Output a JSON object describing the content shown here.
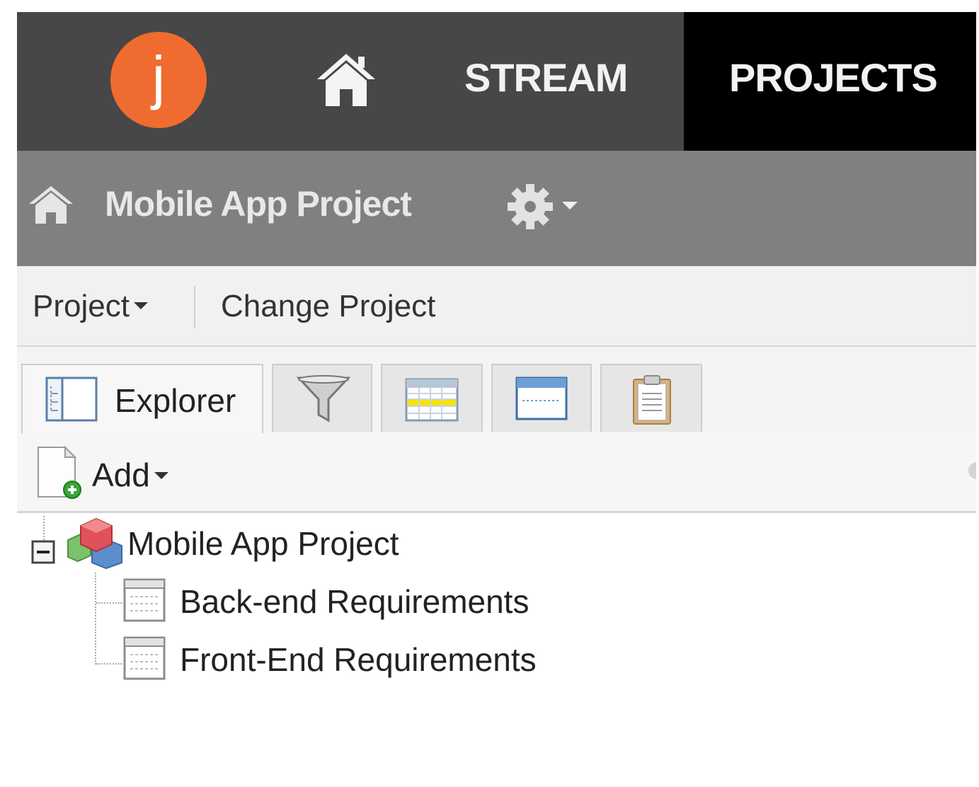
{
  "topnav": {
    "logo_letter": "j",
    "stream_label": "STREAM",
    "projects_label": "PROJECTS",
    "home_icon": "home-icon",
    "colors": {
      "bar": "#474747",
      "active": "#000000",
      "logo": "#f06b2f"
    }
  },
  "project_header": {
    "title": "Mobile App Project",
    "home_icon": "home-icon",
    "settings_icon": "gear-icon",
    "bar_color": "#808080"
  },
  "menubar": {
    "project_menu": "Project",
    "change_project": "Change Project"
  },
  "tabs": [
    {
      "label": "Explorer",
      "icon": "explorer-icon",
      "active": true
    },
    {
      "label": "",
      "icon": "filter-icon",
      "active": false
    },
    {
      "label": "",
      "icon": "grid-icon",
      "active": false
    },
    {
      "label": "",
      "icon": "form-icon",
      "active": false
    },
    {
      "label": "",
      "icon": "clipboard-icon",
      "active": false
    }
  ],
  "toolbar": {
    "add_label": "Add"
  },
  "tree": {
    "root": {
      "label": "Mobile App Project",
      "icon": "cubes-icon",
      "expanded": true
    },
    "children": [
      {
        "label": "Back-end Requirements",
        "icon": "document-list-icon"
      },
      {
        "label": "Front-End Requirements",
        "icon": "document-list-icon"
      }
    ]
  }
}
